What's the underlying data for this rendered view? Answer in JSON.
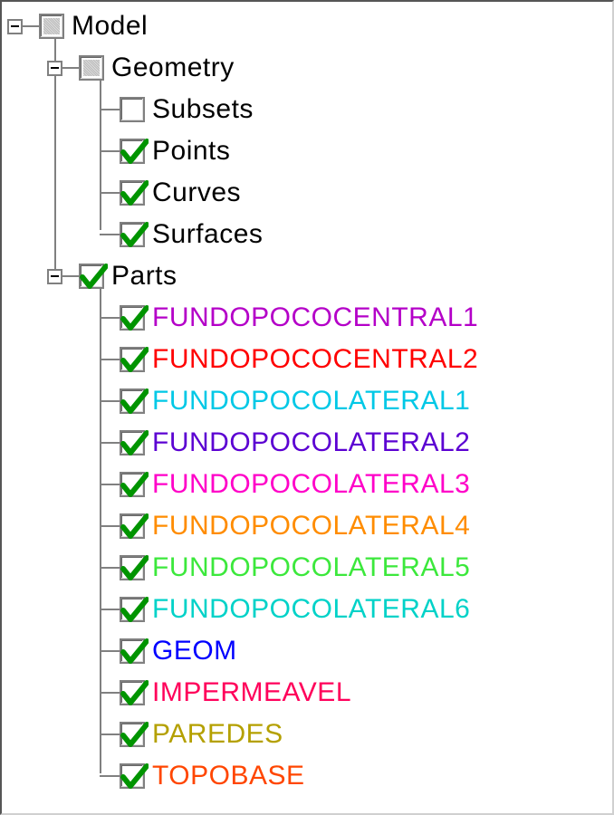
{
  "tree": {
    "root": {
      "label": "Model",
      "expanded": true,
      "check": "tri",
      "children": [
        {
          "key": "geometry",
          "label": "Geometry",
          "expanded": true,
          "check": "tri",
          "children": [
            {
              "key": "subsets",
              "label": "Subsets",
              "check": "unchecked",
              "color": "#000000"
            },
            {
              "key": "points",
              "label": "Points",
              "check": "checked",
              "color": "#000000"
            },
            {
              "key": "curves",
              "label": "Curves",
              "check": "checked",
              "color": "#000000"
            },
            {
              "key": "surfaces",
              "label": "Surfaces",
              "check": "checked",
              "color": "#000000"
            }
          ]
        },
        {
          "key": "parts",
          "label": "Parts",
          "expanded": true,
          "check": "checked",
          "children": [
            {
              "key": "fundopococentral1",
              "label": "FUNDOPOCOCENTRAL1",
              "check": "checked",
              "color": "#B400C8"
            },
            {
              "key": "fundopococentral2",
              "label": "FUNDOPOCOCENTRAL2",
              "check": "checked",
              "color": "#FF0000"
            },
            {
              "key": "fundopocolateral1",
              "label": "FUNDOPOCOLATERAL1",
              "check": "checked",
              "color": "#00C8E6"
            },
            {
              "key": "fundopocolateral2",
              "label": "FUNDOPOCOLATERAL2",
              "check": "checked",
              "color": "#5B00D2"
            },
            {
              "key": "fundopocolateral3",
              "label": "FUNDOPOCOLATERAL3",
              "check": "checked",
              "color": "#FF00C8"
            },
            {
              "key": "fundopocolateral4",
              "label": "FUNDOPOCOLATERAL4",
              "check": "checked",
              "color": "#FF8C00"
            },
            {
              "key": "fundopocolateral5",
              "label": "FUNDOPOCOLATERAL5",
              "check": "checked",
              "color": "#3CE83C"
            },
            {
              "key": "fundopocolateral6",
              "label": "FUNDOPOCOLATERAL6",
              "check": "checked",
              "color": "#00D2C8"
            },
            {
              "key": "geom",
              "label": "GEOM",
              "check": "checked",
              "color": "#0000FF"
            },
            {
              "key": "impermeavel",
              "label": "IMPERMEAVEL",
              "check": "checked",
              "color": "#FF005A"
            },
            {
              "key": "paredes",
              "label": "PAREDES",
              "check": "checked",
              "color": "#B4A000"
            },
            {
              "key": "topobase",
              "label": "TOPOBASE",
              "check": "checked",
              "color": "#FF4600"
            }
          ]
        }
      ]
    }
  }
}
